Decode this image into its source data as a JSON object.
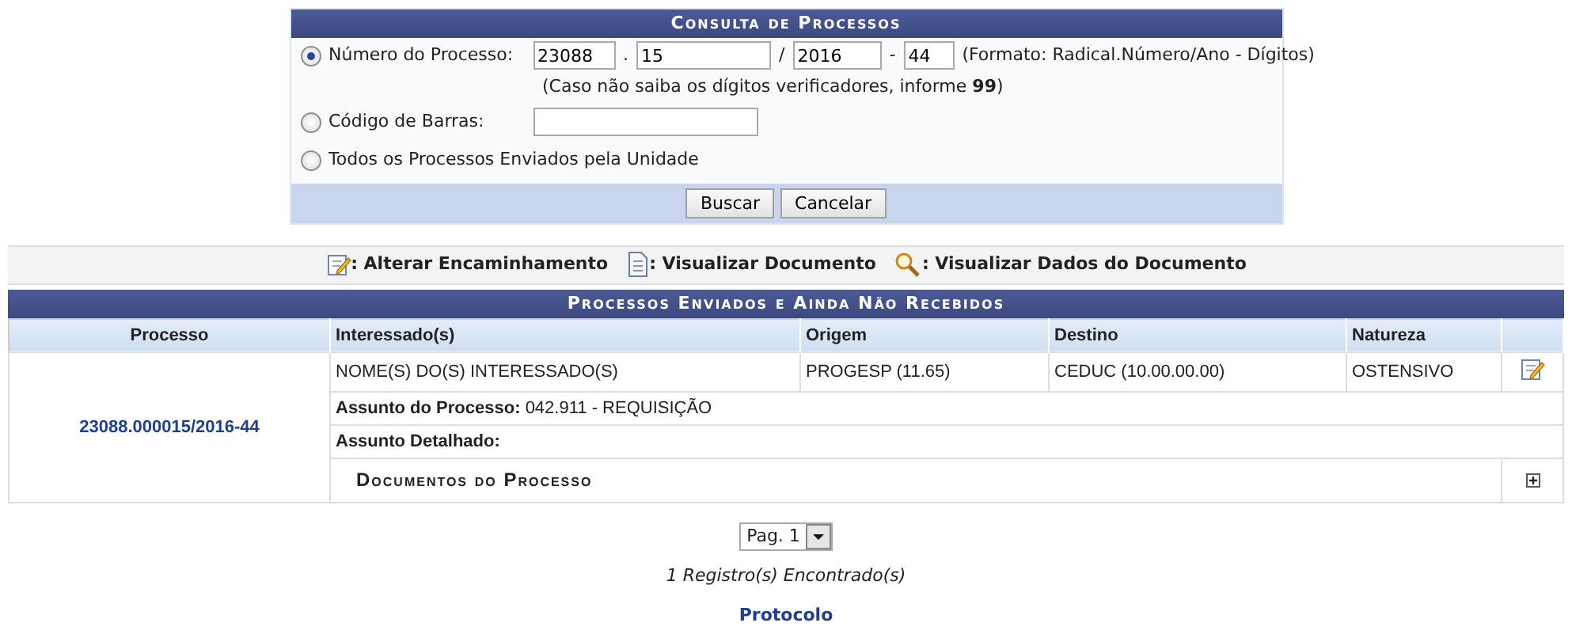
{
  "search_form": {
    "title": "Consulta de Processos",
    "options": [
      {
        "kind": "process_number",
        "label": "Número do Processo:",
        "selected": true,
        "fields": [
          {
            "value": "23088",
            "separator": "."
          },
          {
            "value": "15",
            "separator": "/"
          },
          {
            "value": "2016",
            "separator": "-"
          },
          {
            "value": "44"
          }
        ],
        "format_note": "(Formato: Radical.Número/Ano - Dígitos)",
        "hint": "(Caso não saiba os dígitos verificadores, informe **99**)"
      },
      {
        "kind": "barcode",
        "label": "Código de Barras:",
        "selected": false
      },
      {
        "kind": "plain",
        "label": "Todos os Processos Enviados pela Unidade",
        "selected": false
      }
    ],
    "buttons": [
      "Buscar",
      "Cancelar"
    ]
  },
  "legend": [
    {
      "kind": "edit",
      "label": ": Alterar Encaminhamento"
    },
    {
      "kind": "document",
      "label": ": Visualizar Documento"
    },
    {
      "kind": "search",
      "label": ": Visualizar Dados do Documento"
    }
  ],
  "table": {
    "caption": "Processos Enviados e Ainda Não Recebidos",
    "columns": [
      "Processo",
      "Interessado(s)",
      "Origem",
      "Destino",
      "Natureza"
    ],
    "rows": [
      {
        "cells": [
          "23088.000015/2016-44",
          "NOME(S) DO(S) INTERESSADO(S)",
          "PROGESP (11.65)",
          "CEDUC (10.00.00.00)",
          "OSTENSIVO"
        ],
        "subject_label": "Assunto do Processo:",
        "subject": "042.911 - REQUISIÇÃO",
        "detail_label": "Assunto Detalhado:",
        "documents_title": "Documentos do Processo"
      }
    ]
  },
  "pager": {
    "value": "Pag. 1"
  },
  "result_count": "1 Registro(s) Encontrado(s)",
  "footer_link": "Protocolo"
}
